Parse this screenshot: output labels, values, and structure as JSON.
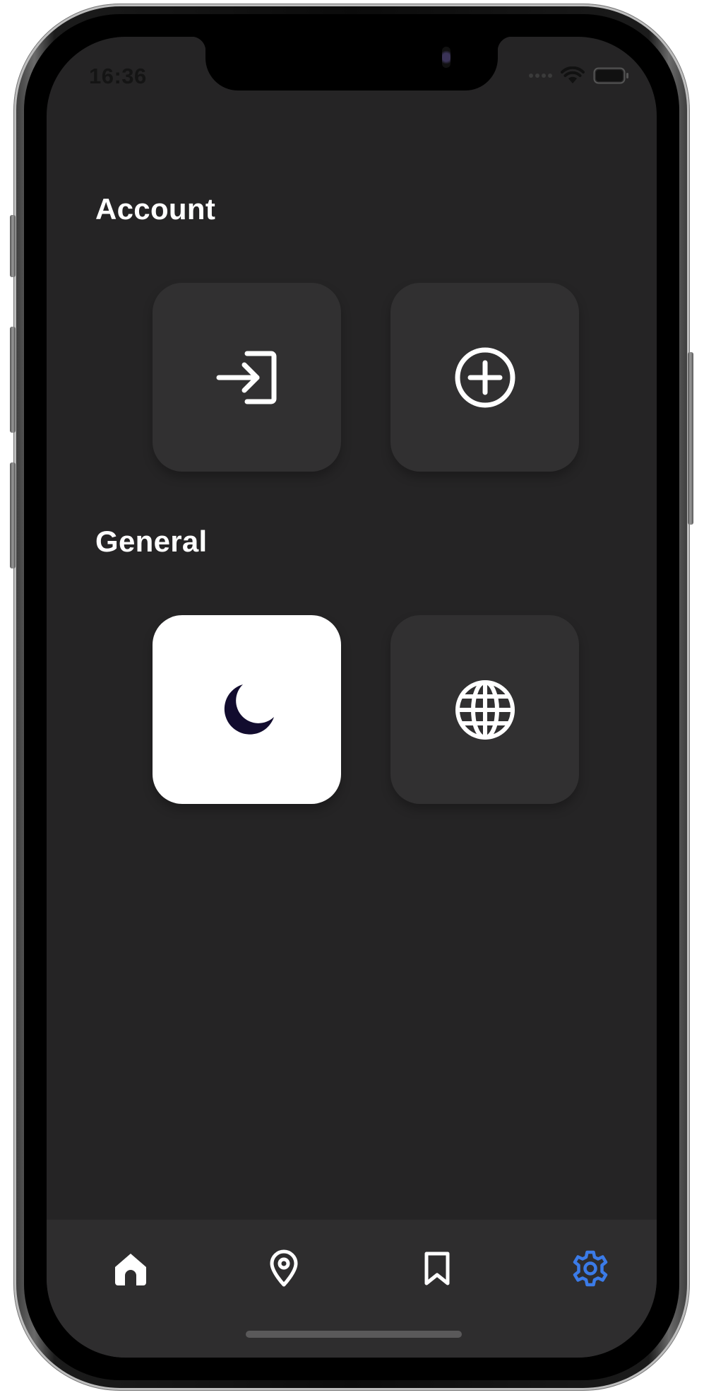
{
  "status_bar": {
    "time": "16:36"
  },
  "sections": {
    "account": {
      "title": "Account"
    },
    "general": {
      "title": "General"
    }
  },
  "tiles": {
    "login": {
      "icon": "login-icon"
    },
    "add": {
      "icon": "add-circle-icon"
    },
    "dark_mode": {
      "icon": "moon-icon",
      "active": true
    },
    "language": {
      "icon": "globe-icon"
    }
  },
  "tab_bar": {
    "items": [
      {
        "icon": "home-icon",
        "active": false
      },
      {
        "icon": "location-pin-icon",
        "active": false
      },
      {
        "icon": "bookmark-icon",
        "active": false
      },
      {
        "icon": "gear-icon",
        "active": true
      }
    ]
  },
  "colors": {
    "screen_background": "#252425",
    "tile_background": "#313031",
    "tile_active_background": "#ffffff",
    "accent": "#3b7be8",
    "moon": "#120c2e",
    "text": "#ffffff"
  }
}
